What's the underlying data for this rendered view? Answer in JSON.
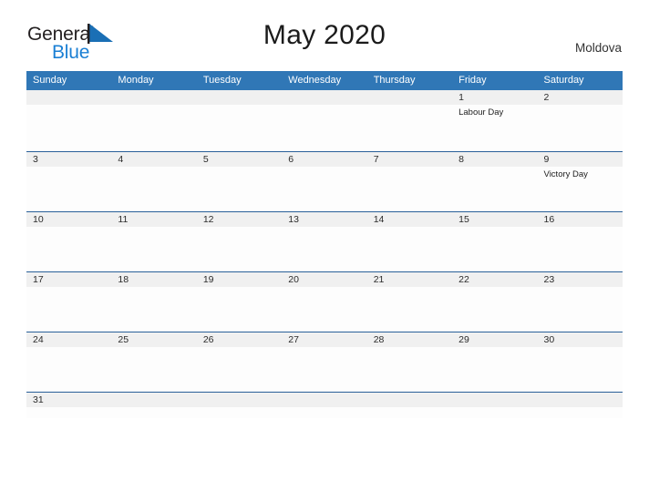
{
  "brand": {
    "name_part1": "General",
    "name_part2": "Blue",
    "color_dark": "#231f20",
    "color_blue": "#1a7fd4"
  },
  "header": {
    "title": "May 2020",
    "region": "Moldova"
  },
  "theme": {
    "header_blue": "#3077b6",
    "rule_blue": "#2a6099",
    "band_gray": "#f0f0f0"
  },
  "calendar": {
    "weekday_headers": [
      "Sunday",
      "Monday",
      "Tuesday",
      "Wednesday",
      "Thursday",
      "Friday",
      "Saturday"
    ],
    "weeks": [
      [
        {
          "date": "",
          "event": ""
        },
        {
          "date": "",
          "event": ""
        },
        {
          "date": "",
          "event": ""
        },
        {
          "date": "",
          "event": ""
        },
        {
          "date": "",
          "event": ""
        },
        {
          "date": "1",
          "event": "Labour Day"
        },
        {
          "date": "2",
          "event": ""
        }
      ],
      [
        {
          "date": "3",
          "event": ""
        },
        {
          "date": "4",
          "event": ""
        },
        {
          "date": "5",
          "event": ""
        },
        {
          "date": "6",
          "event": ""
        },
        {
          "date": "7",
          "event": ""
        },
        {
          "date": "8",
          "event": ""
        },
        {
          "date": "9",
          "event": "Victory Day"
        }
      ],
      [
        {
          "date": "10",
          "event": ""
        },
        {
          "date": "11",
          "event": ""
        },
        {
          "date": "12",
          "event": ""
        },
        {
          "date": "13",
          "event": ""
        },
        {
          "date": "14",
          "event": ""
        },
        {
          "date": "15",
          "event": ""
        },
        {
          "date": "16",
          "event": ""
        }
      ],
      [
        {
          "date": "17",
          "event": ""
        },
        {
          "date": "18",
          "event": ""
        },
        {
          "date": "19",
          "event": ""
        },
        {
          "date": "20",
          "event": ""
        },
        {
          "date": "21",
          "event": ""
        },
        {
          "date": "22",
          "event": ""
        },
        {
          "date": "23",
          "event": ""
        }
      ],
      [
        {
          "date": "24",
          "event": ""
        },
        {
          "date": "25",
          "event": ""
        },
        {
          "date": "26",
          "event": ""
        },
        {
          "date": "27",
          "event": ""
        },
        {
          "date": "28",
          "event": ""
        },
        {
          "date": "29",
          "event": ""
        },
        {
          "date": "30",
          "event": ""
        }
      ],
      [
        {
          "date": "31",
          "event": ""
        },
        {
          "date": "",
          "event": ""
        },
        {
          "date": "",
          "event": ""
        },
        {
          "date": "",
          "event": ""
        },
        {
          "date": "",
          "event": ""
        },
        {
          "date": "",
          "event": ""
        },
        {
          "date": "",
          "event": ""
        }
      ]
    ]
  }
}
